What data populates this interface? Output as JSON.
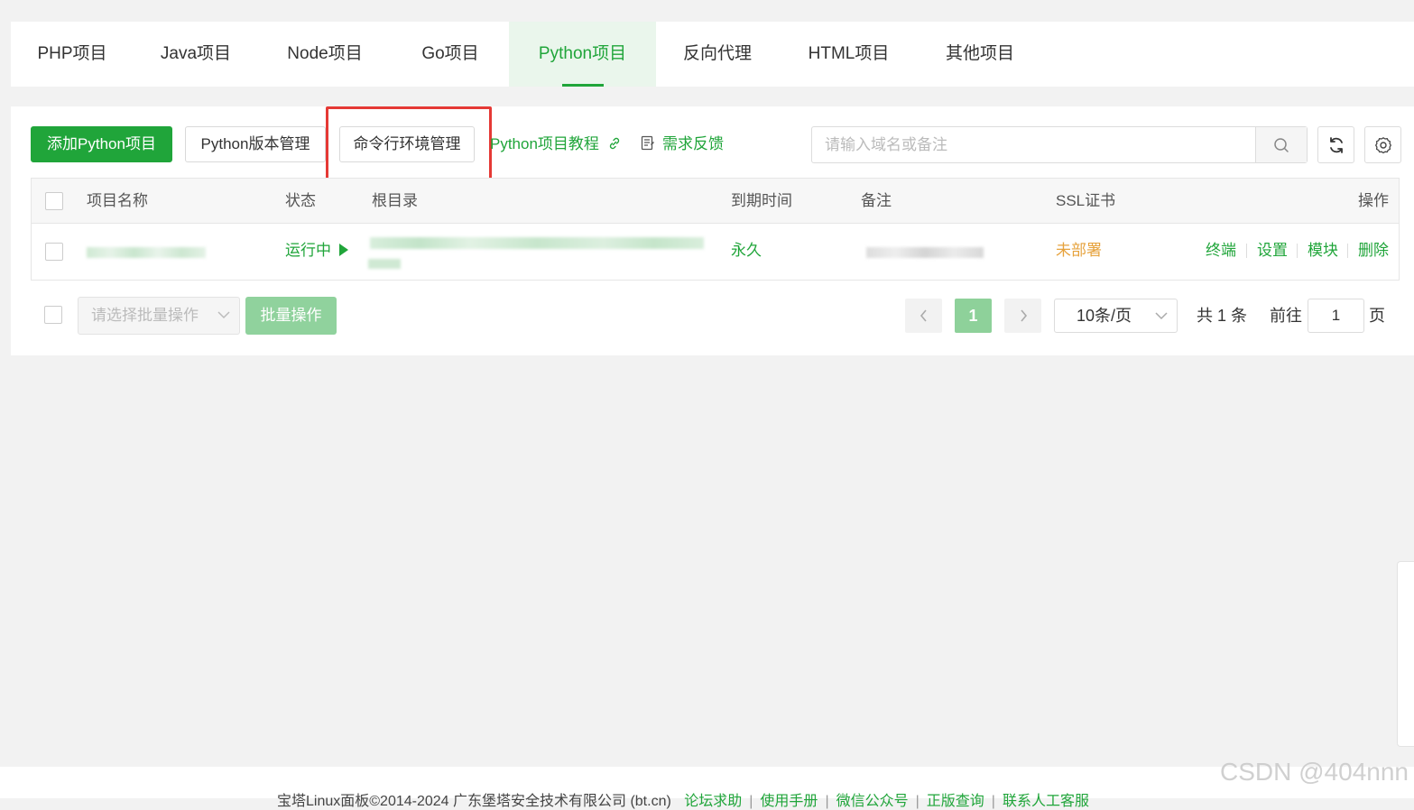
{
  "tabs": [
    {
      "label": "PHP项目",
      "active": false
    },
    {
      "label": "Java项目",
      "active": false
    },
    {
      "label": "Node项目",
      "active": false
    },
    {
      "label": "Go项目",
      "active": false
    },
    {
      "label": "Python项目",
      "active": true
    },
    {
      "label": "反向代理",
      "active": false
    },
    {
      "label": "HTML项目",
      "active": false
    },
    {
      "label": "其他项目",
      "active": false
    }
  ],
  "toolbar": {
    "add_label": "添加Python项目",
    "version_label": "Python版本管理",
    "cli_env_label": "命令行环境管理",
    "tutorial_label": "Python项目教程",
    "feedback_label": "需求反馈",
    "search_placeholder": "请输入域名或备注"
  },
  "table": {
    "headers": {
      "name": "项目名称",
      "status": "状态",
      "root": "根目录",
      "expire": "到期时间",
      "remark": "备注",
      "ssl": "SSL证书",
      "ops": "操作"
    },
    "rows": [
      {
        "status": "运行中",
        "expire": "永久",
        "ssl": "未部署",
        "ops": [
          "终端",
          "设置",
          "模块",
          "删除"
        ]
      }
    ]
  },
  "batch": {
    "select_placeholder": "请选择批量操作",
    "button_label": "批量操作"
  },
  "pagination": {
    "current_page": "1",
    "page_size": "10条/页",
    "total_text": "共 1 条",
    "goto_label": "前往",
    "goto_value": "1",
    "page_suffix": "页"
  },
  "footer": {
    "copyright": "宝塔Linux面板©2014-2024 广东堡塔安全技术有限公司 (bt.cn)",
    "links": [
      "论坛求助",
      "使用手册",
      "微信公众号",
      "正版查询",
      "联系人工客服"
    ]
  },
  "watermark": "CSDN @404nnn",
  "colors": {
    "accent": "#20a53a",
    "ssl_warning": "#e6a23c",
    "highlight": "#e53935"
  }
}
